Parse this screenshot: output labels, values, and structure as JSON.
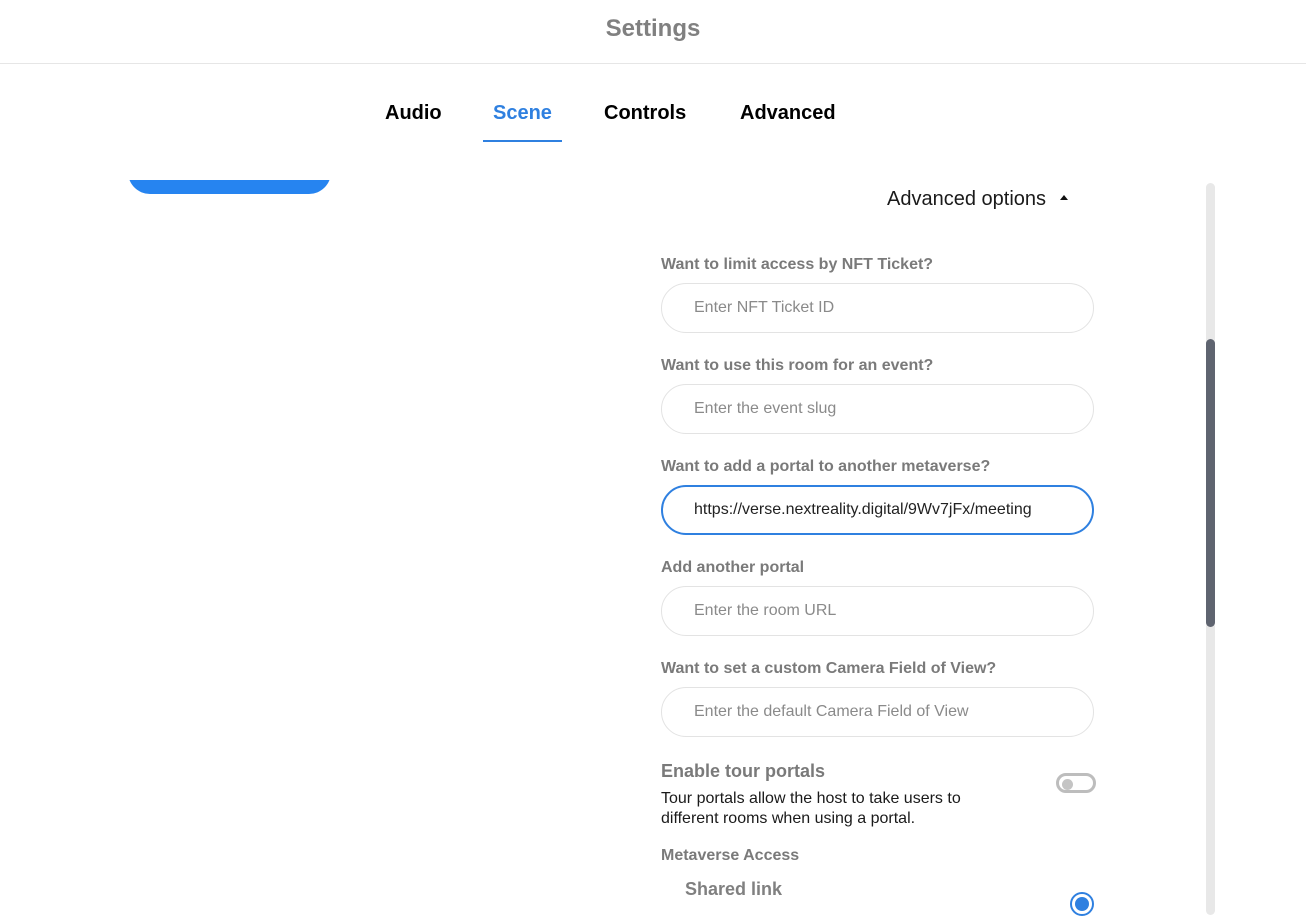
{
  "header": {
    "title": "Settings"
  },
  "tabs": [
    {
      "label": "Audio",
      "active": false
    },
    {
      "label": "Scene",
      "active": true
    },
    {
      "label": "Controls",
      "active": false
    },
    {
      "label": "Advanced",
      "active": false
    }
  ],
  "colors": {
    "accent": "#2f80e0",
    "button_blue": "#2684f0",
    "label_gray": "#7a7a7a",
    "scroll_thumb": "#5f6470"
  },
  "advanced_options": {
    "label": "Advanced options",
    "icon": "caret-up-icon",
    "expanded": true
  },
  "fields": [
    {
      "label": "Want to limit access by NFT Ticket?",
      "placeholder": "Enter NFT Ticket ID",
      "value": ""
    },
    {
      "label": "Want to use this room for an event?",
      "placeholder": "Enter the event slug",
      "value": ""
    },
    {
      "label": "Want to add a portal to another metaverse?",
      "placeholder": "",
      "value": "https://verse.nextreality.digital/9Wv7jFx/meeting",
      "focused": true
    },
    {
      "label": "Add another portal",
      "placeholder": "Enter the room URL",
      "value": ""
    },
    {
      "label": "Want to set a custom Camera Field of View?",
      "placeholder": "Enter the default Camera Field of View",
      "value": ""
    }
  ],
  "tour_portals": {
    "title": "Enable tour portals",
    "description": "Tour portals allow the host to take users to different rooms when using a portal.",
    "enabled": false
  },
  "metaverse_access": {
    "label": "Metaverse Access",
    "options": [
      {
        "label": "Shared link",
        "selected": true
      }
    ]
  }
}
